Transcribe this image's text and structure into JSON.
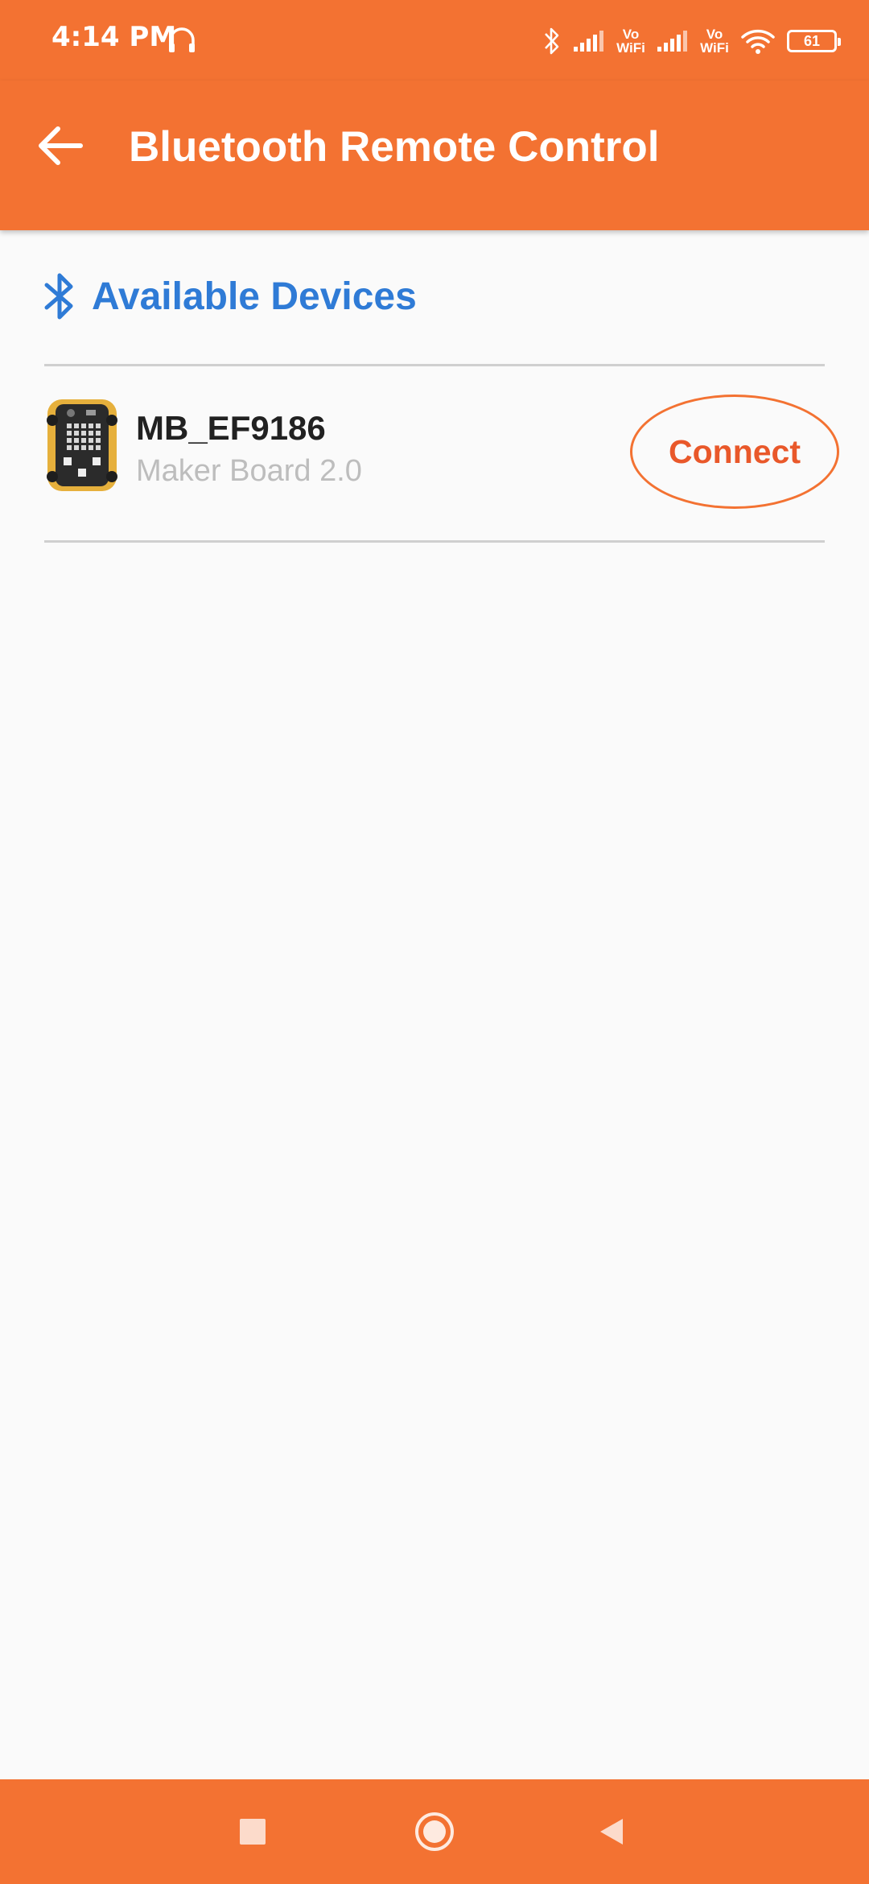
{
  "status_bar": {
    "time": "4:14 PM",
    "vowifi_1": "Vo\nWiFi",
    "vowifi_2": "Vo\nWiFi",
    "battery": "61",
    "icons": [
      "headset-icon",
      "bluetooth-icon",
      "signal-icon",
      "vowifi-icon",
      "signal-icon",
      "vowifi-icon",
      "wifi-icon",
      "battery-icon"
    ]
  },
  "app_bar": {
    "back_icon": "arrow-left-icon",
    "title": "Bluetooth Remote Control"
  },
  "section": {
    "icon": "bluetooth-icon",
    "title": "Available Devices"
  },
  "devices": [
    {
      "name": "MB_EF9186",
      "model": "Maker Board 2.0",
      "action_label": "Connect",
      "image": "maker-board-image"
    }
  ],
  "nav_bar": {
    "icons": [
      "square-recents-icon",
      "circle-home-icon",
      "triangle-back-icon"
    ]
  },
  "colors": {
    "primary": "#f37232",
    "section_title": "#2f7bd6",
    "connect_text": "#e9582a",
    "background": "#fafafa"
  }
}
